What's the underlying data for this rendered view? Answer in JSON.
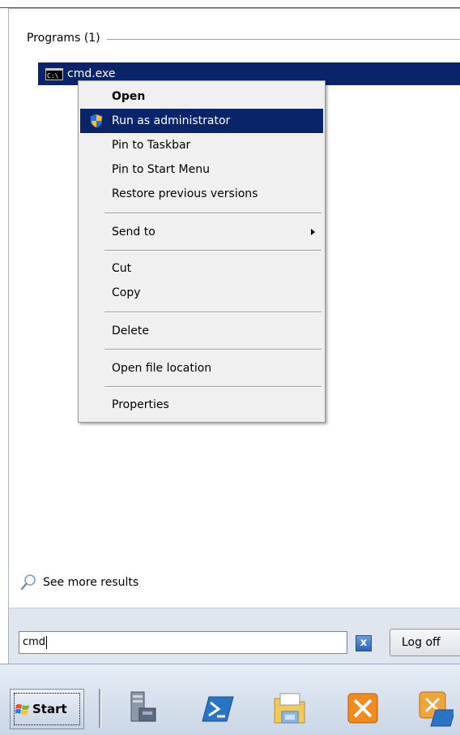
{
  "results": {
    "group_label": "Programs (1)",
    "program": {
      "name": "cmd.exe",
      "icon": "console-icon",
      "icon_text": "C:\\"
    },
    "see_more": "See more results"
  },
  "context_menu": {
    "open": "Open",
    "run_as_admin": "Run as administrator",
    "pin_taskbar": "Pin to Taskbar",
    "pin_start": "Pin to Start Menu",
    "restore": "Restore previous versions",
    "send_to": "Send to",
    "cut": "Cut",
    "copy": "Copy",
    "delete": "Delete",
    "open_location": "Open file location",
    "properties": "Properties"
  },
  "search": {
    "value": "cmd",
    "clear_label": "x"
  },
  "power": {
    "logoff_label": "Log off"
  },
  "taskbar": {
    "start_label": "Start",
    "pinned": [
      "server-manager-icon",
      "powershell-icon",
      "explorer-icon",
      "exchange-console-icon",
      "exchange-shell-icon"
    ]
  },
  "colors": {
    "selection": "#0a246a",
    "menu_bg": "#f0f0f0",
    "strip_bg": "#dfe6ee"
  }
}
